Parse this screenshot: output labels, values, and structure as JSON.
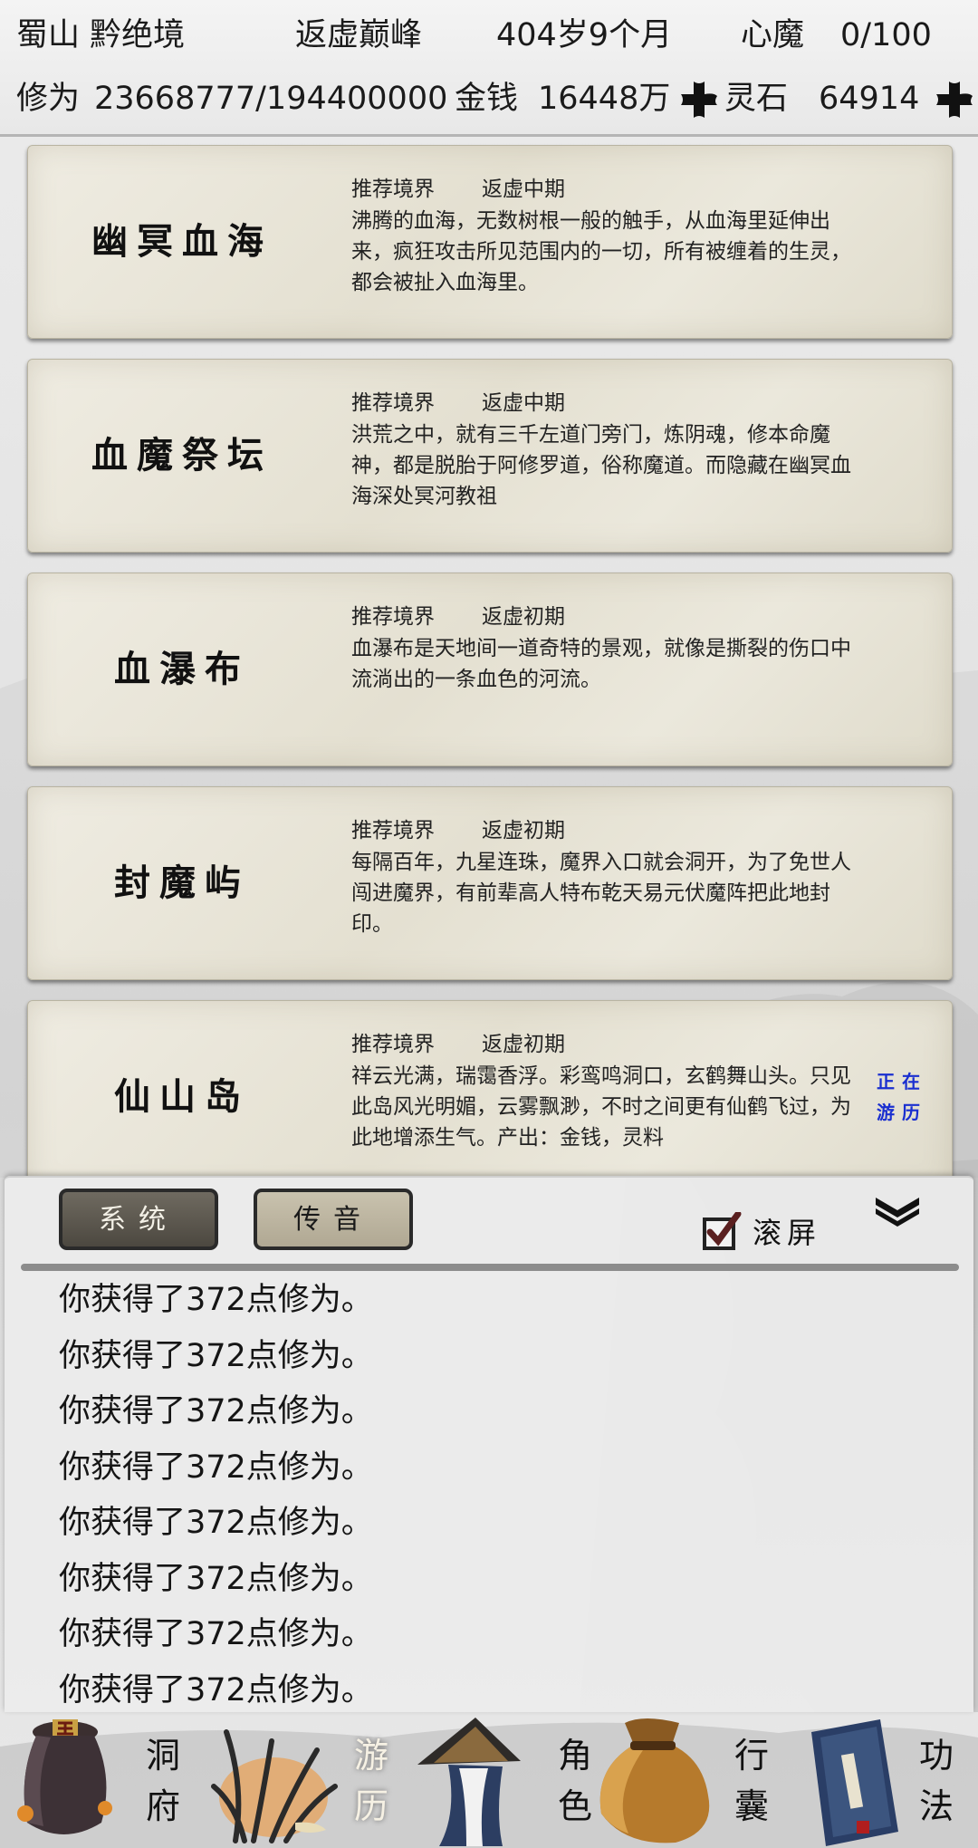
{
  "header": {
    "location": "蜀山 黔绝境",
    "realm": "返虚巅峰",
    "age": "404岁9个月",
    "heart_demon_label": "心魔",
    "heart_demon_value": "0/100",
    "cultivation_label": "修为",
    "cultivation_value": "23668777/194400000",
    "money_label": "金钱",
    "money_value": "16448万",
    "spirit_stone_label": "灵石",
    "spirit_stone_value": "64914"
  },
  "cards": [
    {
      "name": "幽冥血海",
      "rec_label": "推荐境界",
      "rec_value": "返虚中期",
      "desc": "沸腾的血海，无数树根一般的触手，从血海里延伸出来，疯狂攻击所见范围内的一切，所有被缠着的生灵，都会被扯入血海里。"
    },
    {
      "name": "血魔祭坛",
      "rec_label": "推荐境界",
      "rec_value": "返虚中期",
      "desc": "洪荒之中，就有三千左道门旁门，炼阴魂，修本命魔神，都是脱胎于阿修罗道，俗称魔道。而隐藏在幽冥血海深处冥河教祖"
    },
    {
      "name": "血瀑布",
      "rec_label": "推荐境界",
      "rec_value": "返虚初期",
      "desc": "血瀑布是天地间一道奇特的景观，就像是撕裂的伤口中流淌出的一条血色的河流。"
    },
    {
      "name": "封魔屿",
      "rec_label": "推荐境界",
      "rec_value": "返虚初期",
      "desc": "每隔百年，九星连珠，魔界入口就会洞开，为了免世人闯进魔界，有前辈高人特布乾天易元伏魔阵把此地封印。"
    },
    {
      "name": "仙山岛",
      "rec_label": "推荐境界",
      "rec_value": "返虚初期",
      "desc": "祥云光满，瑞霭香浮。彩鸾鸣洞口，玄鹤舞山头。只见此岛风光明媚，云雾飘渺，不时之间更有仙鹤飞过，为此地增添生气。产出：金钱，灵料",
      "status": "正在游历"
    }
  ],
  "chat": {
    "tab_system": "系统",
    "tab_message": "传音",
    "scroll_label": "滚屏",
    "scroll_checked": true,
    "lines": [
      "你获得了372点修为。",
      "你获得了372点修为。",
      "你获得了372点修为。",
      "你获得了372点修为。",
      "你获得了372点修为。",
      "你获得了372点修为。",
      "你获得了372点修为。",
      "你获得了372点修为。"
    ]
  },
  "nav": [
    {
      "label_top": "洞",
      "label_bottom": "府",
      "icon": "cave-bag-icon"
    },
    {
      "label_top": "游",
      "label_bottom": "历",
      "icon": "travel-grass-icon",
      "active": true
    },
    {
      "label_top": "角",
      "label_bottom": "色",
      "icon": "character-hat-icon"
    },
    {
      "label_top": "行",
      "label_bottom": "囊",
      "icon": "bag-icon"
    },
    {
      "label_top": "功",
      "label_bottom": "法",
      "icon": "scripture-book-icon"
    }
  ],
  "colors": {
    "status_blue": "#1a2fd0",
    "tab_active_bg": "#57534a",
    "tab_inactive_bg": "#bdb59f"
  }
}
